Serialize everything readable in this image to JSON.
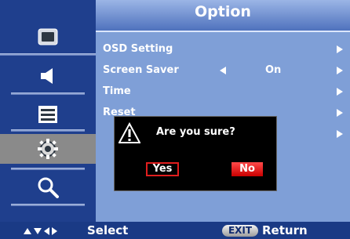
{
  "menu": {
    "title": "Option",
    "items": [
      {
        "label": "OSD Setting",
        "value": "",
        "has_left_arrow": false
      },
      {
        "label": "Screen Saver",
        "value": "On",
        "has_left_arrow": true
      },
      {
        "label": "Time",
        "value": "",
        "has_left_arrow": false
      },
      {
        "label": "Reset",
        "value": "",
        "has_left_arrow": false
      },
      {
        "label": "",
        "value": "",
        "has_left_arrow": false
      }
    ]
  },
  "sidebar": {
    "items": [
      {
        "icon": "screen-icon",
        "selected": false
      },
      {
        "icon": "speaker-icon",
        "selected": false
      },
      {
        "icon": "list-icon",
        "selected": false
      },
      {
        "icon": "gear-icon",
        "selected": true
      },
      {
        "icon": "search-icon",
        "selected": false
      }
    ]
  },
  "dialog": {
    "icon": "warning-icon",
    "message": "Are you sure?",
    "yes_label": "Yes",
    "no_label": "No"
  },
  "footer": {
    "nav_icons": [
      "up-arrow-icon",
      "down-arrow-icon",
      "left-arrow-icon",
      "right-arrow-icon"
    ],
    "select_label": "Select",
    "exit_label": "EXIT",
    "return_label": "Return"
  },
  "colors": {
    "accent_red": "#e01e1e",
    "panel_blue": "#7f9fd7",
    "selected_gray": "#8a8a8a"
  }
}
